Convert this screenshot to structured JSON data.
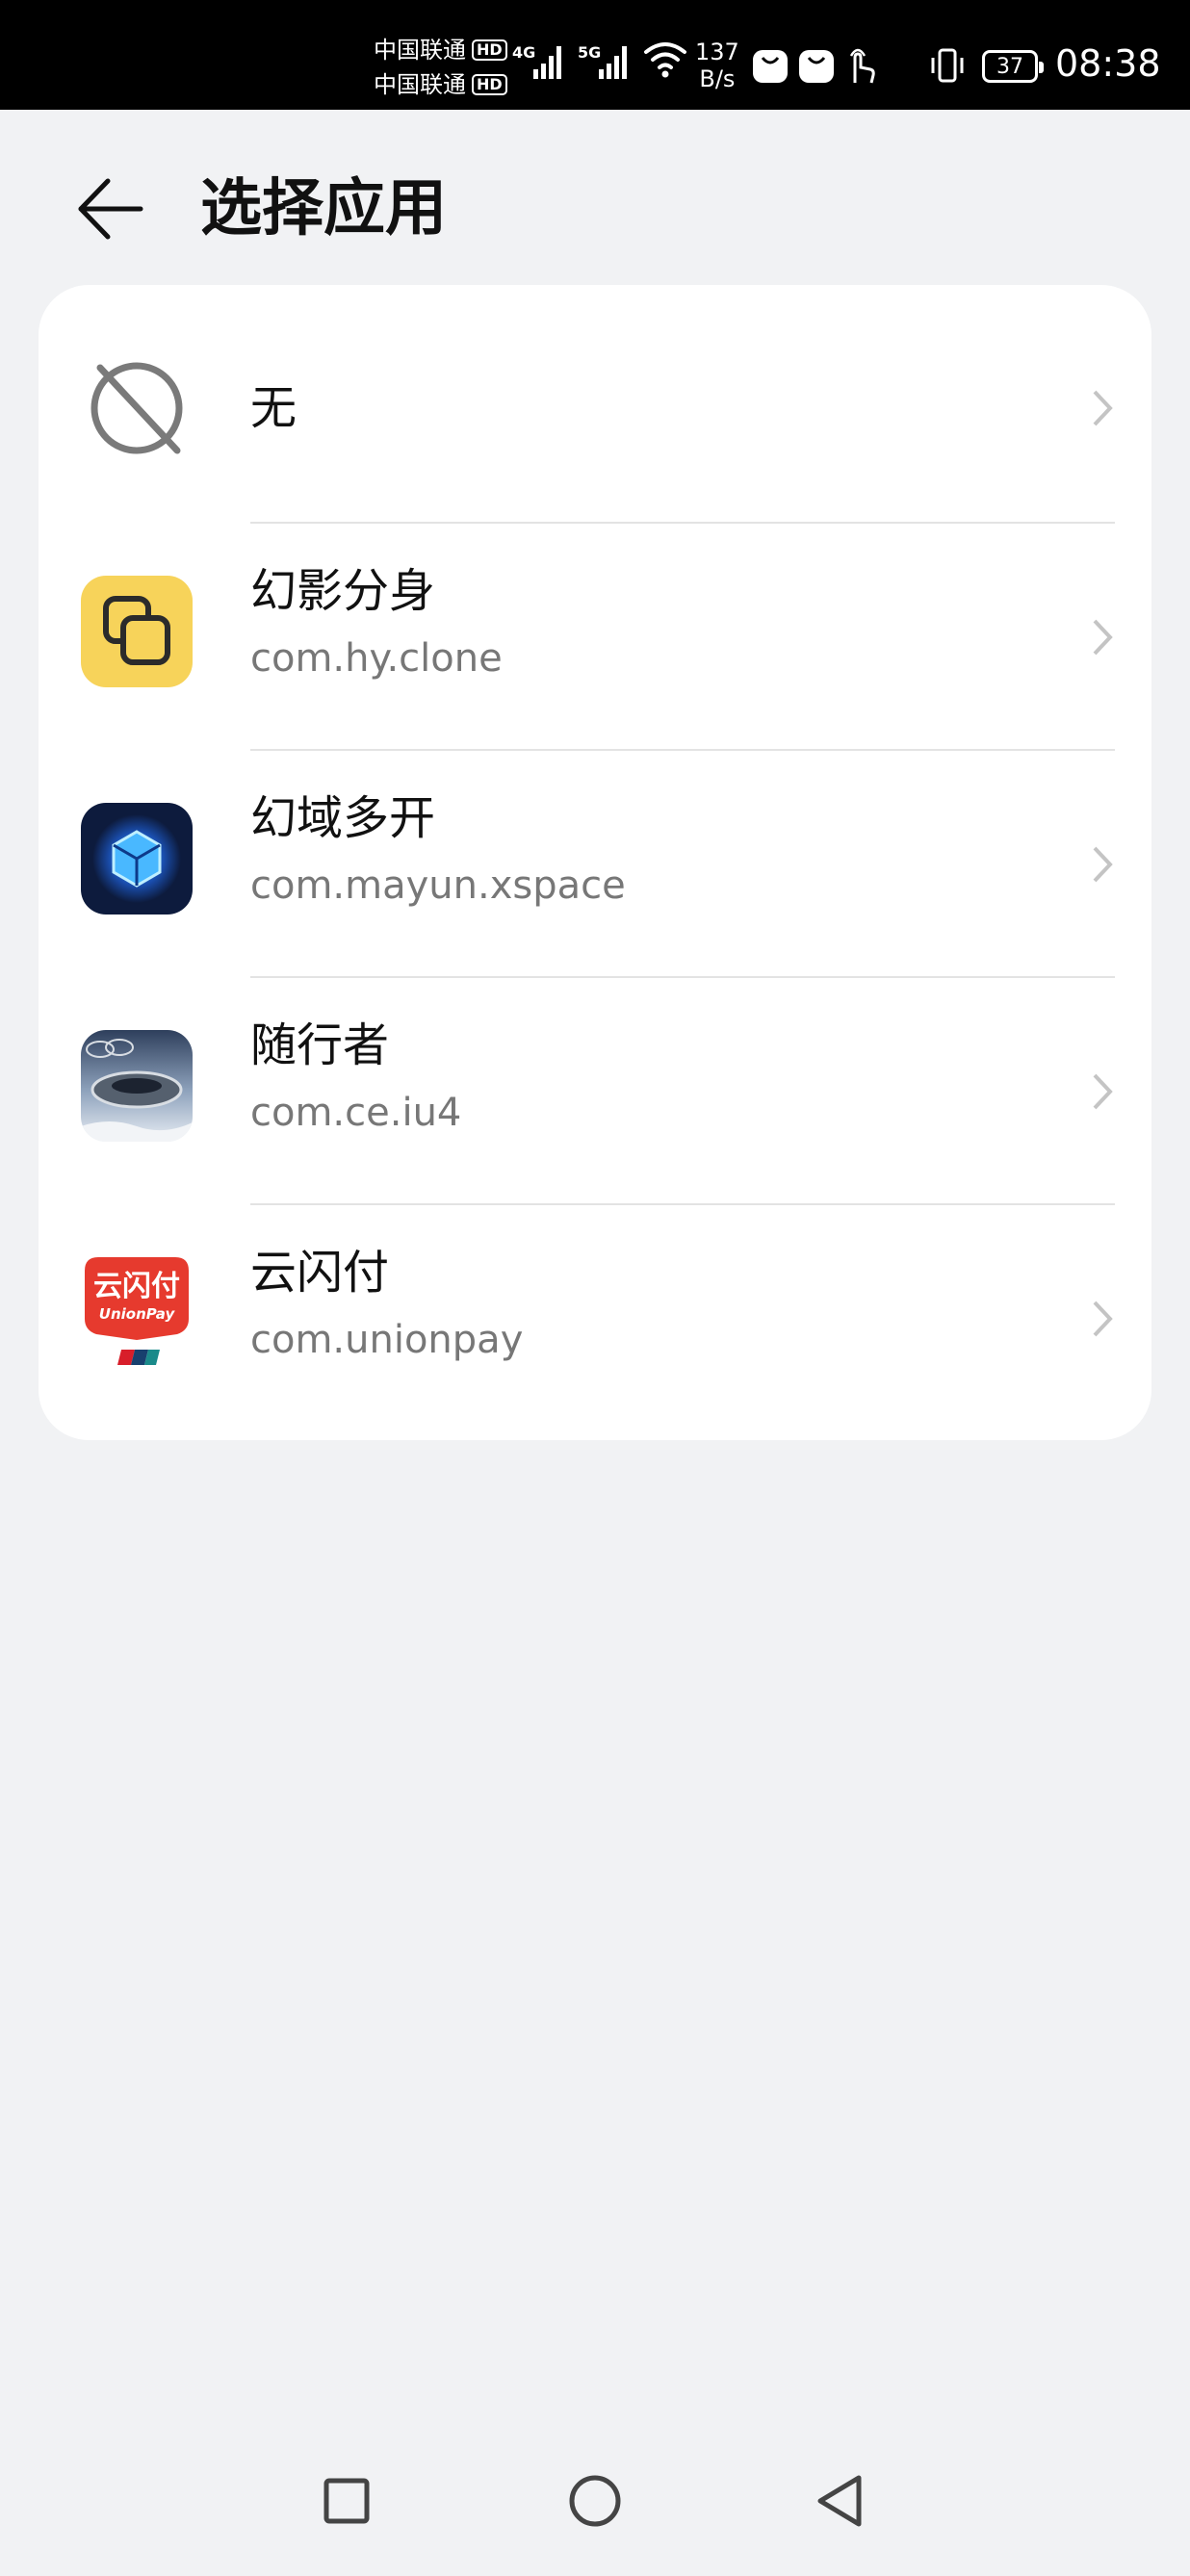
{
  "status_bar": {
    "carrier1": "中国联通",
    "carrier2": "中国联通",
    "hd_label": "HD",
    "net_4g": "4G",
    "net_5g": "5G",
    "net_speed_value": "137",
    "net_speed_unit": "B/s",
    "battery_level": "37",
    "time": "08:38"
  },
  "header": {
    "title": "选择应用"
  },
  "apps": [
    {
      "name": "无",
      "package": "",
      "icon": "prohibited-icon"
    },
    {
      "name": "幻影分身",
      "package": "com.hy.clone",
      "icon": "hy-clone-app-icon",
      "color": "#f7d35a"
    },
    {
      "name": "幻域多开",
      "package": "com.mayun.xspace",
      "icon": "mayun-xspace-app-icon",
      "color": "#0d1b3d"
    },
    {
      "name": "随行者",
      "package": "com.ce.iu4",
      "icon": "ce-iu4-app-icon",
      "color": "#6a7d98"
    },
    {
      "name": "云闪付",
      "package": "com.unionpay",
      "icon": "unionpay-app-icon",
      "color": "#e63a2e"
    }
  ],
  "unionpay_icon_text": "云闪付",
  "unionpay_icon_subtext": "UnionPay",
  "navigation": {
    "recent": "square-icon",
    "home": "circle-icon",
    "back": "triangle-back-icon"
  }
}
